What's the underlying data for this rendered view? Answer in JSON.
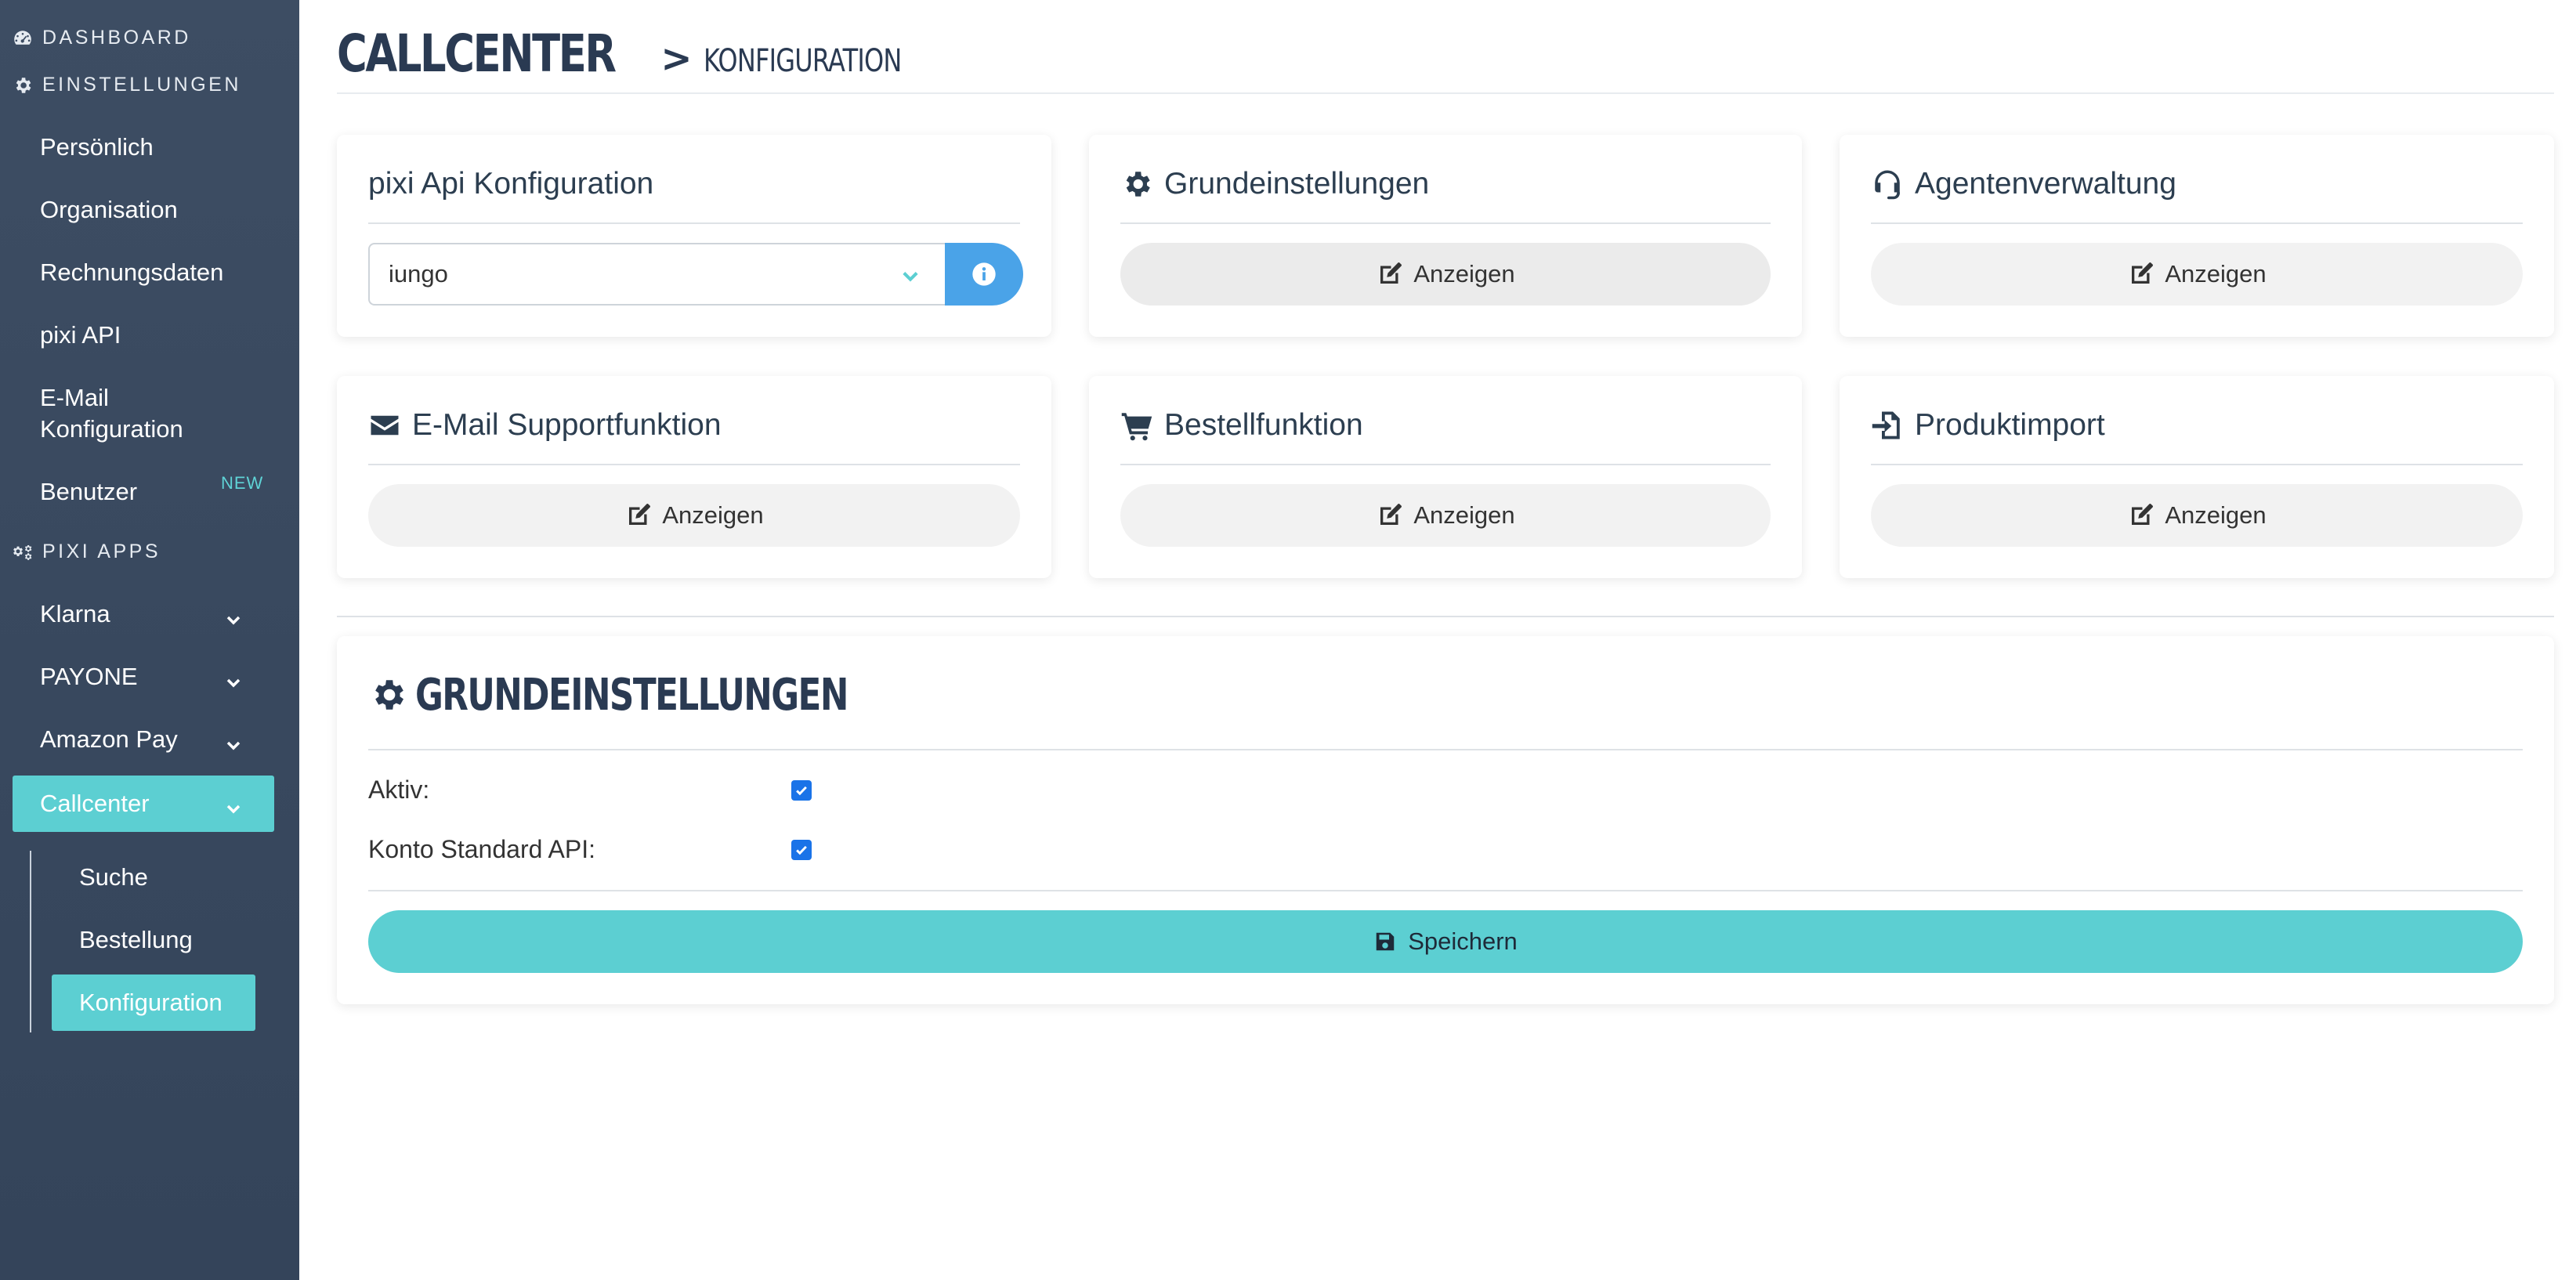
{
  "sidebar": {
    "sections": {
      "dashboard": "Dashboard",
      "einstellungen": "Einstellungen",
      "pixi_apps": "pixi Apps"
    },
    "settings_items": [
      "Persönlich",
      "Organisation",
      "Rechnungsdaten",
      "pixi API",
      "E-Mail",
      "Konfiguration",
      "Benutzer"
    ],
    "new_badge": "NEW",
    "apps": [
      "Klarna",
      "PAYONE",
      "Amazon Pay",
      "Callcenter"
    ],
    "callcenter_sub": [
      "Suche",
      "Bestellung",
      "Konfiguration"
    ]
  },
  "header": {
    "title": "Callcenter",
    "separator": ">",
    "subtitle": "Konfiguration"
  },
  "cards": {
    "api": {
      "title": "pixi Api Konfiguration",
      "select_value": "iungo"
    },
    "grund": {
      "title": "Grundeinstellungen",
      "button": "Anzeigen"
    },
    "agent": {
      "title": "Agentenverwaltung",
      "button": "Anzeigen"
    },
    "email": {
      "title": "E-Mail Supportfunktion",
      "button": "Anzeigen"
    },
    "bestell": {
      "title": "Bestellfunktion",
      "button": "Anzeigen"
    },
    "produkt": {
      "title": "Produktimport",
      "button": "Anzeigen"
    }
  },
  "settings_panel": {
    "title": "Grundeinstellungen",
    "fields": [
      {
        "label": "Aktiv:",
        "checked": true
      },
      {
        "label": "Konto Standard API:",
        "checked": true
      }
    ],
    "save_label": "Speichern"
  },
  "colors": {
    "accent": "#5ccfd2",
    "info": "#4aa3e8",
    "sidebar_bg": "#3d4d63",
    "text_dark": "#2c3e50"
  }
}
